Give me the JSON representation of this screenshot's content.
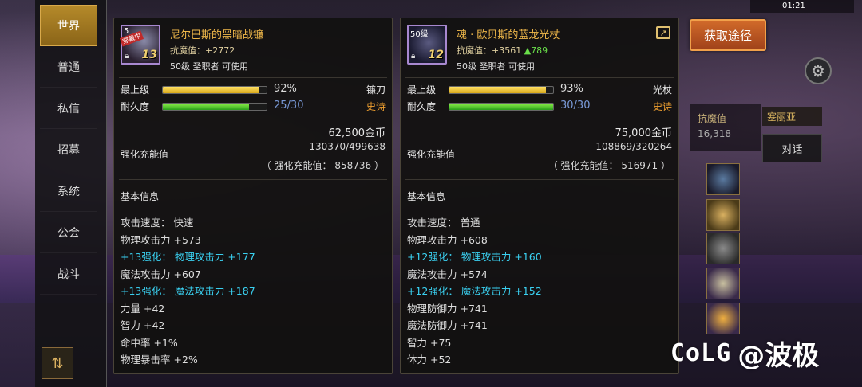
{
  "chat": {
    "tabs": [
      "世界",
      "普通",
      "私信",
      "招募",
      "系统",
      "公会",
      "战斗"
    ],
    "active_index": 0
  },
  "status_bar": {
    "time": "01:21"
  },
  "acquire_button": "获取途径",
  "side_info": {
    "resist_label": "抗魔值",
    "resist_value": "16,318",
    "npc_name": "塞丽亚",
    "dialog_button": "对话"
  },
  "watermark": {
    "logo": "CoLG",
    "handle": "@波极"
  },
  "left_item": {
    "icon_level": "5",
    "icon_badge": "穿戴中",
    "icon_enhance": "13",
    "name": "尼尔巴斯的黑暗战镰",
    "resist": "抗魔值：+2772",
    "resist_up": "",
    "usable": "50级 圣职者 可使用",
    "max_level_label": "最上级",
    "max_level_pct": "92%",
    "max_level_fraction": 0.92,
    "weapon_type": "镰刀",
    "durability_label": "耐久度",
    "durability": "25/30",
    "durability_fraction": 0.833,
    "rarity": "史诗",
    "price": "62,500金币",
    "charge_label": "强化充能值",
    "charge_value": "130370/499638",
    "charge_detail": "（ 强化充能值： 858736 ）",
    "basic_title": "基本信息",
    "stats": [
      {
        "text": "攻击速度： 快速",
        "cyan": false
      },
      {
        "text": "物理攻击力 +573",
        "cyan": false
      },
      {
        "text": "+13强化： 物理攻击力 +177",
        "cyan": true
      },
      {
        "text": "魔法攻击力 +607",
        "cyan": false
      },
      {
        "text": "+13强化： 魔法攻击力 +187",
        "cyan": true
      },
      {
        "text": "力量 +42",
        "cyan": false
      },
      {
        "text": "智力 +42",
        "cyan": false
      },
      {
        "text": "命中率 +1%",
        "cyan": false
      },
      {
        "text": "物理暴击率 +2%",
        "cyan": false
      }
    ]
  },
  "right_item": {
    "icon_level": "50级",
    "icon_enhance": "12",
    "name": "魂 · 欧贝斯的蓝龙光杖",
    "resist": "抗魔值：+3561 ",
    "resist_up": "▲789",
    "usable": "50级 圣职者 可使用",
    "max_level_label": "最上级",
    "max_level_pct": "93%",
    "max_level_fraction": 0.93,
    "weapon_type": "光杖",
    "durability_label": "耐久度",
    "durability": "30/30",
    "durability_fraction": 1.0,
    "rarity": "史诗",
    "price": "75,000金币",
    "charge_label": "强化充能值",
    "charge_value": "108869/320264",
    "charge_detail": "（ 强化充能值： 516971 ）",
    "basic_title": "基本信息",
    "stats": [
      {
        "text": "攻击速度： 普通",
        "cyan": false
      },
      {
        "text": "物理攻击力 +608",
        "cyan": false
      },
      {
        "text": "+12强化： 物理攻击力 +160",
        "cyan": true
      },
      {
        "text": "魔法攻击力 +574",
        "cyan": false
      },
      {
        "text": "+12强化： 魔法攻击力 +152",
        "cyan": true
      },
      {
        "text": "物理防御力 +741",
        "cyan": false
      },
      {
        "text": "魔法防御力 +741",
        "cyan": false
      },
      {
        "text": "智力 +75",
        "cyan": false
      },
      {
        "text": "体力 +52",
        "cyan": false
      }
    ]
  }
}
